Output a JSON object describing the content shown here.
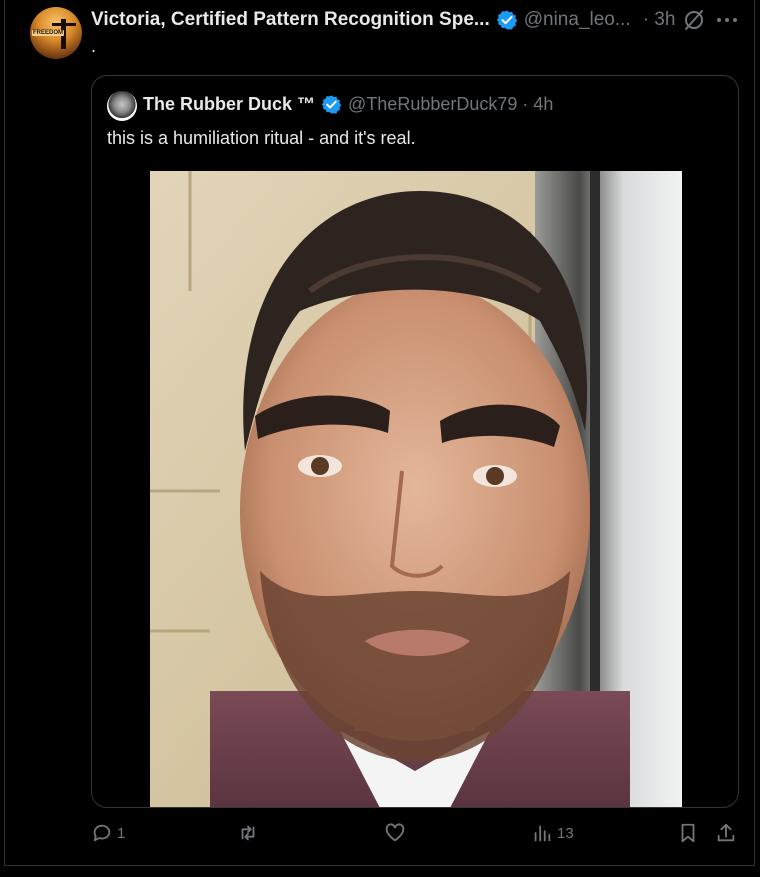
{
  "post": {
    "author": {
      "display_name": "Victoria, Certified Pattern Recognition Spe...",
      "handle": "@nina_leo...",
      "avatar_label": "FREEDOM"
    },
    "time": "· 3h",
    "text": ".",
    "quoted": {
      "display_name": "The Rubber Duck ™",
      "handle": "@TheRubberDuck79 · 4h",
      "text": "this is a humiliation ritual - and it's real."
    },
    "actions": {
      "reply_count": "1",
      "retweet_count": "",
      "like_count": "",
      "views_count": "13"
    }
  },
  "colors": {
    "background": "#000000",
    "text": "#e7e9ea",
    "muted": "#71767b",
    "verified": "#1d9bf0",
    "border": "#2f3336"
  },
  "icons": [
    "verified-badge-icon",
    "grok-icon",
    "more-icon",
    "reply-icon",
    "retweet-icon",
    "like-icon",
    "views-icon",
    "bookmark-icon",
    "share-icon"
  ]
}
